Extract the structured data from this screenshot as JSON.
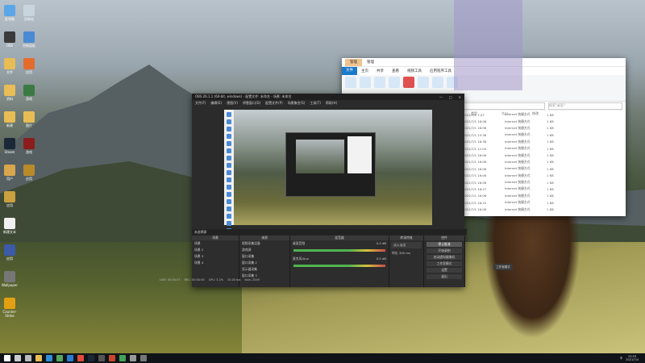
{
  "desktop": {
    "icons": [
      {
        "name": "this-pc",
        "label": "此电脑",
        "color": "#5aa6e6"
      },
      {
        "name": "recycle-bin",
        "label": "回收站",
        "color": "#c8d4de"
      },
      {
        "name": "obs-icon",
        "label": "OBS",
        "color": "#3a3a3a"
      },
      {
        "name": "control-panel",
        "label": "控制面板",
        "color": "#4a8ad4"
      },
      {
        "name": "folder-1",
        "label": "文件",
        "color": "#e8bd55"
      },
      {
        "name": "app-orange",
        "label": "应用",
        "color": "#e56b2c"
      },
      {
        "name": "folder-2",
        "label": "资料",
        "color": "#e8bd55"
      },
      {
        "name": "game-1",
        "label": "游戏",
        "color": "#3c7a44"
      },
      {
        "name": "folder-3",
        "label": "新建",
        "color": "#e8bd55"
      },
      {
        "name": "folder-4",
        "label": "图片",
        "color": "#e8bd55"
      },
      {
        "name": "steam-icon",
        "label": "Steam",
        "color": "#1b2838"
      },
      {
        "name": "game-2",
        "label": "游戏",
        "color": "#8b1d1d"
      },
      {
        "name": "user-icon",
        "label": "用户",
        "color": "#d8a64d"
      },
      {
        "name": "game-3",
        "label": "应用",
        "color": "#b98a2a"
      },
      {
        "name": "game-4",
        "label": "应用",
        "color": "#c9a13f"
      },
      {
        "name": "doc-icon",
        "label": "新建文本",
        "color": "#f0f0f0"
      },
      {
        "name": "app-blue",
        "label": "应用",
        "color": "#3b5aa8"
      },
      {
        "name": "app-grey",
        "label": "Wallpaper",
        "color": "#777777"
      },
      {
        "name": "counter-strike",
        "label": "Counter-Strike",
        "color": "#e2a012"
      }
    ]
  },
  "explorer": {
    "tabs": [
      "管理",
      "管理"
    ],
    "menu": [
      "文件",
      "主页",
      "共享",
      "查看",
      "视频工具",
      "应用程序工具"
    ],
    "search_placeholder": "搜索\"桌面\"",
    "columns": [
      "类型",
      "大小",
      "修改"
    ],
    "rows": [
      {
        "date": "2021/7/1 7:47",
        "type": "Internet 快捷方式",
        "size": "1 KB"
      },
      {
        "date": "2021/7/1 16:06",
        "type": "Internet 快捷方式",
        "size": "1 KB"
      },
      {
        "date": "2021/7/1 16:06",
        "type": "Internet 快捷方式",
        "size": "1 KB"
      },
      {
        "date": "2021/7/1 13:38",
        "type": "Internet 快捷方式",
        "size": "1 KB"
      },
      {
        "date": "2021/7/1 16:38",
        "type": "Internet 快捷方式",
        "size": "1 KB"
      },
      {
        "date": "2021/7/1 11:04",
        "type": "Internet 快捷方式",
        "size": "1 KB"
      },
      {
        "date": "2021/7/1 16:06",
        "type": "Internet 快捷方式",
        "size": "1 KB"
      },
      {
        "date": "2021/7/1 16:06",
        "type": "Internet 快捷方式",
        "size": "1 KB"
      },
      {
        "date": "2021/7/1 16:06",
        "type": "Internet 快捷方式",
        "size": "1 KB"
      },
      {
        "date": "2021/7/1 16:06",
        "type": "Internet 快捷方式",
        "size": "1 KB"
      },
      {
        "date": "2021/7/1 16:06",
        "type": "Internet 快捷方式",
        "size": "1 KB"
      },
      {
        "date": "2021/7/1 16:27",
        "type": "Internet 快捷方式",
        "size": "1 KB"
      },
      {
        "date": "2021/7/1 16:06",
        "type": "Internet 快捷方式",
        "size": "1 KB"
      },
      {
        "date": "2021/7/1 16:10",
        "type": "Internet 快捷方式",
        "size": "1 KB"
      },
      {
        "date": "2021/7/1 16:06",
        "type": "Internet 快捷方式",
        "size": "1 KB"
      }
    ]
  },
  "obs": {
    "title": "OBS 26.1.1 (64-bit, windows) - 配置文件: 未命名 - 场景: 未命名",
    "menu": [
      "文件(F)",
      "编辑(E)",
      "视图(V)",
      "停靠窗口(D)",
      "配置文件(P)",
      "场景集合(S)",
      "工具(T)",
      "帮助(H)"
    ],
    "scene_bar": "未选择源",
    "scenes_header": "场景",
    "scenes": [
      "场景",
      "场景 2",
      "场景 3",
      "场景 4"
    ],
    "sources_header": "来源",
    "sources": [
      "视频采集设备",
      "游戏源",
      "窗口采集",
      "窗口采集 2",
      "显示器采集",
      "窗口采集 3"
    ],
    "mixer_header": "混音器",
    "mixer": [
      {
        "name": "桌面音频",
        "db": "0.0 dB"
      },
      {
        "name": "麦克风/Aux",
        "db": "0.0 dB"
      }
    ],
    "transitions_header": "转场特效",
    "transition_type": "淡入淡出",
    "duration_label": "时长",
    "duration_value": "300 ms",
    "controls_header": "控件",
    "controls": [
      {
        "label": "停止推流",
        "active": true
      },
      {
        "label": "开始录制",
        "active": false
      },
      {
        "label": "启动虚拟摄像机",
        "active": false
      },
      {
        "label": "工作室模式",
        "active": false
      },
      {
        "label": "设置",
        "active": false
      },
      {
        "label": "退出",
        "active": false
      }
    ],
    "status": [
      "LIVE: 00:00:07",
      "REC: 00:00:00",
      "CPU: 3.2%",
      "30.00 fps",
      "kb/s: 2549"
    ],
    "studio_mode_label": "工作室模式"
  },
  "taskbar": {
    "time": "23:53",
    "date": "2021/7/4",
    "lang": "中",
    "icons": [
      "start",
      "search",
      "task-view",
      "explorer",
      "edge",
      "store",
      "mail",
      "chrome",
      "steam",
      "obs",
      "app",
      "app2",
      "app3",
      "app4"
    ]
  }
}
